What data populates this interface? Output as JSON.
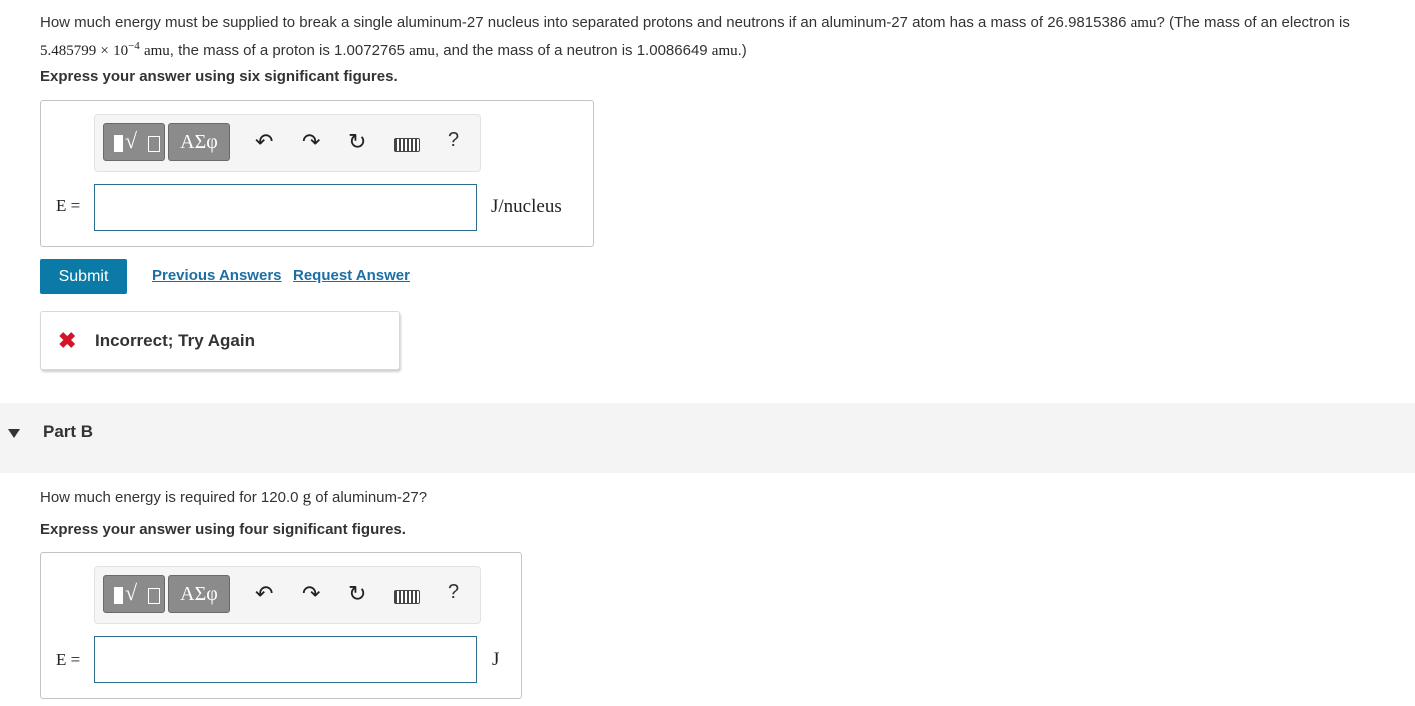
{
  "part_a": {
    "question_pre": "How much energy must be supplied to break a single aluminum-27 nucleus into separated protons and neutrons if an aluminum-27 atom has a mass of 26.9815386 ",
    "unit_amu": "amu",
    "question_mid1": "? (The mass of an electron is ",
    "electron_mass_coef": "5.485799",
    "times": "×",
    "ten": "10",
    "exponent": "−4",
    "question_mid2": ", the mass of a proton is 1.0072765 ",
    "question_mid3": ", and the mass of a neutron is 1.0086649 ",
    "question_end": ".)",
    "instruction": "Express your answer using six significant figures.",
    "label": "E =",
    "unit": "J/nucleus",
    "input_value": ""
  },
  "toolbar": {
    "greek": "ΑΣφ",
    "templates_icon": "templates-sqrt-icon",
    "undo_icon": "↶",
    "redo_icon": "↷",
    "reset_icon": "↻",
    "help": "?"
  },
  "actions": {
    "submit": "Submit",
    "previous_answers": "Previous Answers",
    "request_answer": "Request Answer"
  },
  "feedback": {
    "icon": "✖",
    "text": "Incorrect; Try Again"
  },
  "part_b": {
    "title": "Part B",
    "question_pre": "How much energy is required for 120.0 ",
    "unit_g": "g",
    "question_end": " of aluminum-27?",
    "instruction": "Express your answer using four significant figures.",
    "label": "E =",
    "unit": "J",
    "input_value": ""
  },
  "colors": {
    "submit_bg": "#0c7aa6",
    "link": "#1b6fa5",
    "error": "#d1162a",
    "input_border": "#2d6b8f"
  }
}
